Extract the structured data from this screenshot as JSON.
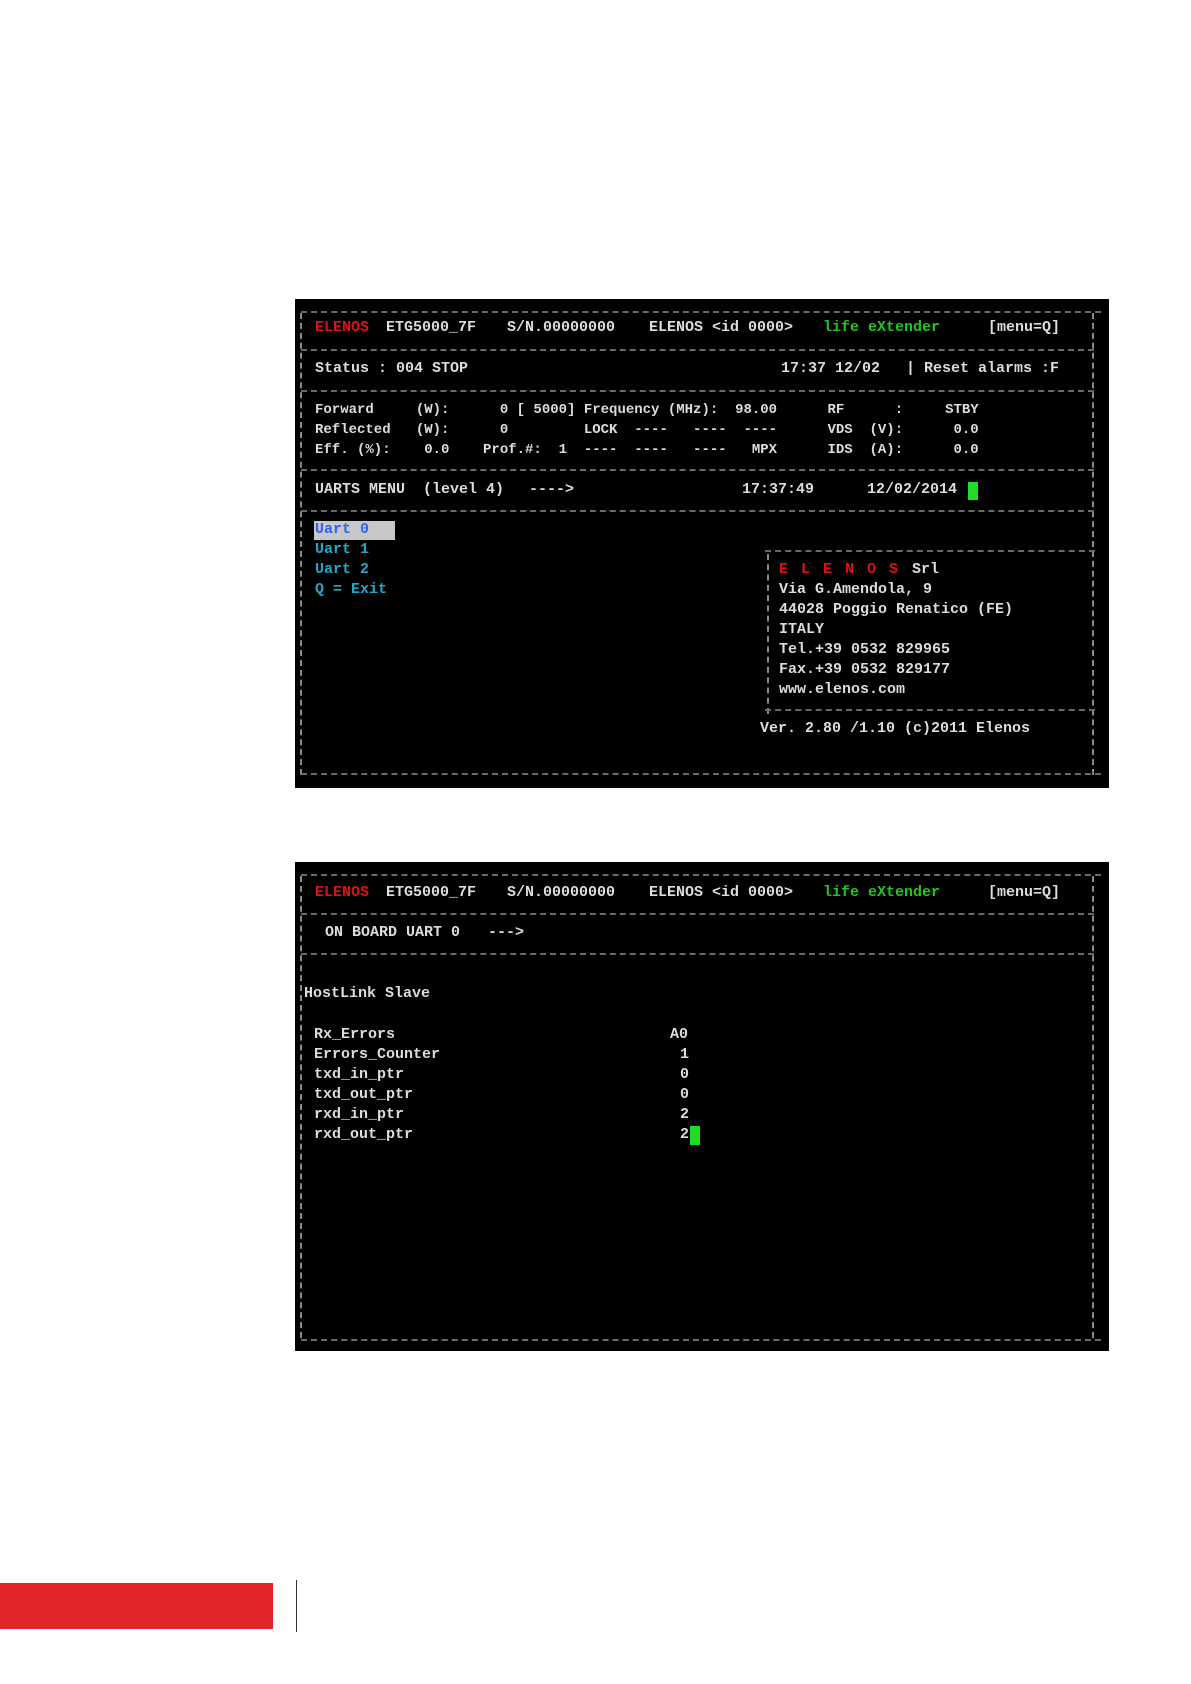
{
  "screen1": {
    "header": {
      "brand": "ELENOS",
      "model": "ETG5000_7F",
      "serial": "S/N.00000000",
      "device_id": "ELENOS <id 0000>",
      "tagline": "life eXtender",
      "menu_hint": "[menu=Q]"
    },
    "status": {
      "text": "Status : 004 STOP",
      "time_date": "17:37 12/02",
      "reset": "Reset alarms :F"
    },
    "measure_rows": [
      "Forward     (W):      0 [ 5000] Frequency (MHz):  98.00      RF      :     STBY",
      "Reflected   (W):      0         LOCK  ----   ----  ----      VDS  (V):      0.0",
      "Eff. (%):    0.0    Prof.#:  1  ----  ----   ----   MPX      IDS  (A):      0.0"
    ],
    "menu_bar": {
      "title": "UARTS MENU  (level 4)",
      "arrow": "---->",
      "time": "17:37:49",
      "date": "12/02/2014"
    },
    "menu_items": [
      "Uart 0",
      "Uart 1",
      "Uart 2",
      "Q = Exit"
    ],
    "company": {
      "name": "E L E N O S",
      "suffix": "Srl",
      "lines": [
        "Via G.Amendola, 9",
        "44028 Poggio Renatico (FE)",
        "ITALY",
        "Tel.+39 0532 829965",
        "Fax.+39 0532 829177",
        "www.elenos.com"
      ]
    },
    "version": "Ver. 2.80 /1.10 (c)2011 Elenos"
  },
  "screen2": {
    "header": {
      "brand": "ELENOS",
      "model": "ETG5000_7F",
      "serial": "S/N.00000000",
      "device_id": "ELENOS <id 0000>",
      "tagline": "life eXtender",
      "menu_hint": "[menu=Q]"
    },
    "section_title": "ON BOARD UART 0",
    "arrow": "--->",
    "mode": "HostLink Slave",
    "fields": [
      {
        "label": "Rx_Errors",
        "value": "A0"
      },
      {
        "label": "Errors_Counter",
        "value": "1"
      },
      {
        "label": "txd_in_ptr",
        "value": "0"
      },
      {
        "label": "txd_out_ptr",
        "value": "0"
      },
      {
        "label": "rxd_in_ptr",
        "value": "2"
      },
      {
        "label": "rxd_out_ptr",
        "value": "2"
      }
    ]
  },
  "colors": {
    "terminal_bg": "#000000",
    "text": "#dcdcdc",
    "brand_red": "#e01010",
    "tagline_green": "#22c51e",
    "menu_cyan": "#20a8c8",
    "cursor_green": "#1fdc25",
    "footer_red": "#e2242b"
  }
}
